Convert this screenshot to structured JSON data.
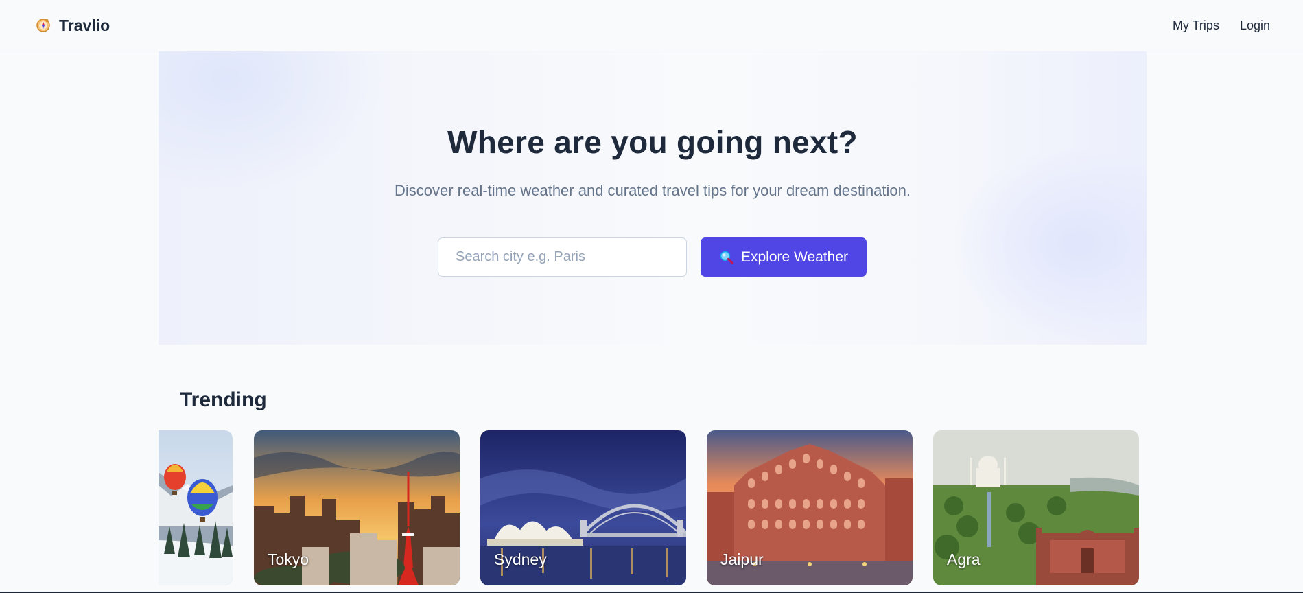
{
  "header": {
    "brand": "Travlio",
    "brand_icon": "compass-icon",
    "nav": [
      "My Trips",
      "Login"
    ]
  },
  "hero": {
    "title": "Where are you going next?",
    "subtitle": "Discover real-time weather and curated travel tips for your dream destination.",
    "search_placeholder": "Search city e.g. Paris",
    "search_value": "",
    "button_label": "Explore Weather",
    "button_icon": "magnifier-icon"
  },
  "trending": {
    "heading": "Trending",
    "cards": [
      {
        "label": "",
        "image": "hot-air-balloons-snow-mountains"
      },
      {
        "label": "Tokyo",
        "image": "tokyo-tower-sunset"
      },
      {
        "label": "Sydney",
        "image": "sydney-opera-house-harbour-bridge"
      },
      {
        "label": "Jaipur",
        "image": "hawa-mahal"
      },
      {
        "label": "Agra",
        "image": "taj-mahal"
      }
    ]
  },
  "colors": {
    "accent": "#4f46e5",
    "text": "#1e293b",
    "muted": "#64748b",
    "background": "#f8fafc"
  }
}
